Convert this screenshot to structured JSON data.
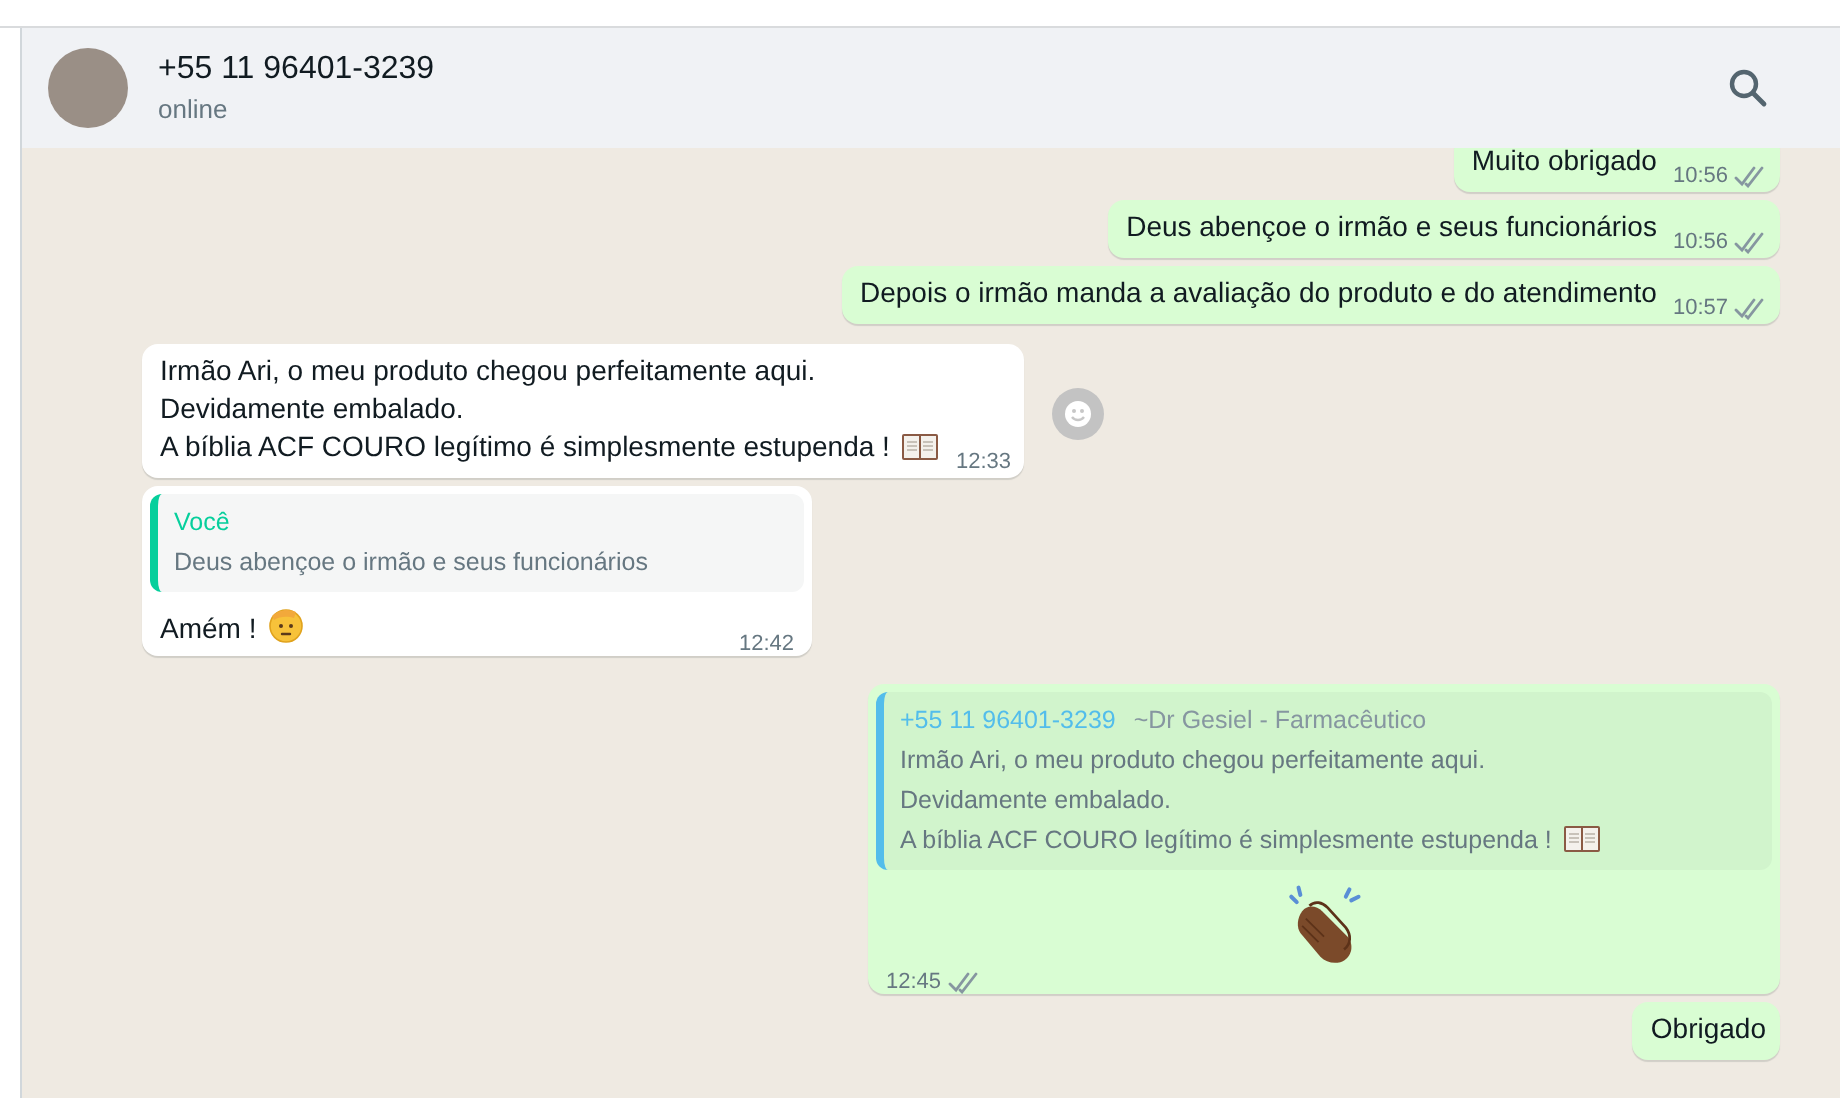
{
  "header": {
    "name": "+55 11 96401-3239",
    "status": "online"
  },
  "messages": [
    {
      "kind": "out",
      "lines": [
        "Muito obrigado"
      ],
      "time": "10:56",
      "read": false
    },
    {
      "kind": "out",
      "lines": [
        "Deus abençoe o irmão e seus funcionários"
      ],
      "time": "10:56",
      "read": false
    },
    {
      "kind": "out",
      "lines": [
        "Depois o irmão manda a avaliação do produto e do atendimento"
      ],
      "time": "10:57",
      "read": false
    },
    {
      "kind": "in",
      "lines": [
        "Irmão Ari, o meu produto chegou perfeitamente aqui.",
        "Devidamente embalado.",
        "A bíblia ACF COURO legítimo é simplesmente estupenda !"
      ],
      "time": "12:33"
    },
    {
      "kind": "in",
      "quote": {
        "author": "Você",
        "lines": [
          "Deus abençoe o irmão e seus funcionários"
        ]
      },
      "lines": [
        "Amém !"
      ],
      "time": "12:42"
    },
    {
      "kind": "out",
      "quote": {
        "author": "+55 11 96401-3239",
        "alias": "~Dr Gesiel - Farmacêutico",
        "lines": [
          "Irmão Ari, o meu produto chegou perfeitamente aqui.",
          "Devidamente embalado.",
          "A bíblia ACF COURO legítimo é simplesmente estupenda !"
        ]
      },
      "time": "12:45",
      "read": false
    },
    {
      "kind": "out",
      "lines": [
        "Obrigado"
      ]
    }
  ]
}
